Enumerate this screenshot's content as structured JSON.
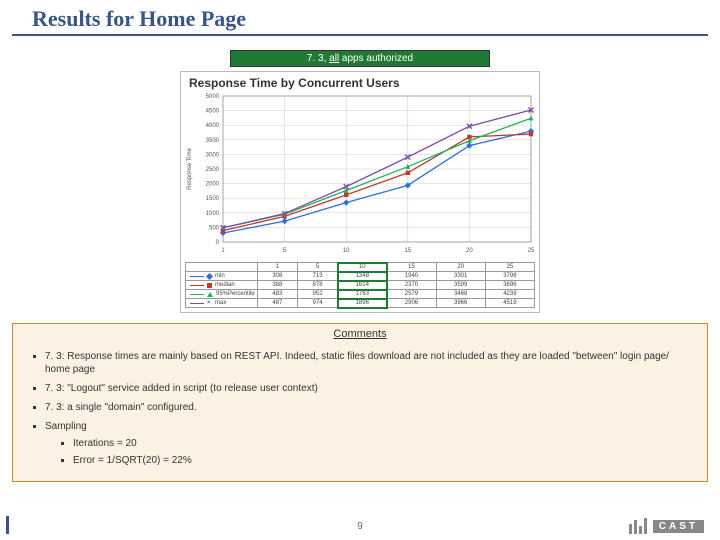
{
  "title": "Results for Home Page",
  "banner": {
    "prefix": "7. 3, ",
    "underlined": "all",
    "suffix": " apps authorized"
  },
  "chart_data": {
    "type": "line",
    "title": "Response Time by Concurrent Users",
    "xlabel": "",
    "ylabel": "Response Time",
    "x": [
      1,
      5,
      10,
      15,
      20,
      25
    ],
    "ylim": [
      0,
      5000
    ],
    "yticks": [
      0,
      500,
      1000,
      1500,
      2000,
      2500,
      3000,
      3500,
      4000,
      4500,
      5000
    ],
    "series": [
      {
        "name": "min",
        "color": "#2e6fdb",
        "marker": "diamond",
        "values": [
          308,
          713,
          1348,
          1940,
          3301,
          3798
        ]
      },
      {
        "name": "median",
        "color": "#c0392b",
        "marker": "square",
        "values": [
          388,
          878,
          1614,
          2370,
          3599,
          3696
        ]
      },
      {
        "name": "95%Percentile",
        "color": "#27ae60",
        "marker": "triangle",
        "values": [
          483,
          952,
          1763,
          2579,
          3468,
          4239
        ]
      },
      {
        "name": "max",
        "color": "#7d4ea8",
        "marker": "cross",
        "values": [
          487,
          974,
          1896,
          2906,
          3966,
          4519
        ]
      }
    ],
    "highlight_x": 10
  },
  "comments": {
    "heading": "Comments",
    "items": [
      "7. 3: Response times are mainly based on REST API. Indeed, static files download are not included as they are loaded \"between\" login page/ home page",
      "7. 3: \"Logout\" service added in script (to release user context)",
      "7. 3: a single \"domain\" configured.",
      "Sampling"
    ],
    "sampling_sub": [
      "Iterations = 20",
      "Error = 1/SQRT(20) = 22%"
    ]
  },
  "footer": {
    "page": "9",
    "logo_text": "CAST"
  }
}
